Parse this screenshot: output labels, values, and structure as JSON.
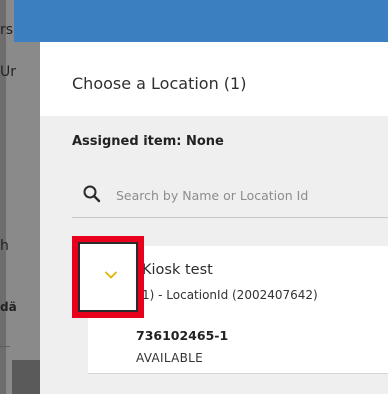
{
  "background": {
    "fragments": [
      "rs",
      "Ur",
      "h",
      "dä"
    ]
  },
  "dialog": {
    "title": "Choose a Location (1)",
    "assigned_label": "Assigned item: None",
    "search": {
      "placeholder": "Search by Name or Location Id",
      "value": ""
    },
    "location": {
      "name": "Kiosk test",
      "detail": "1) - LocationId (2002407642)",
      "item_id": "736102465-1",
      "status": "AVAILABLE"
    }
  },
  "colors": {
    "topbar": "#3b7fc0",
    "highlight": "#e8001c",
    "chevron": "#e0b400"
  },
  "icons": {
    "search": "search-icon",
    "expand": "chevron-down-icon"
  }
}
